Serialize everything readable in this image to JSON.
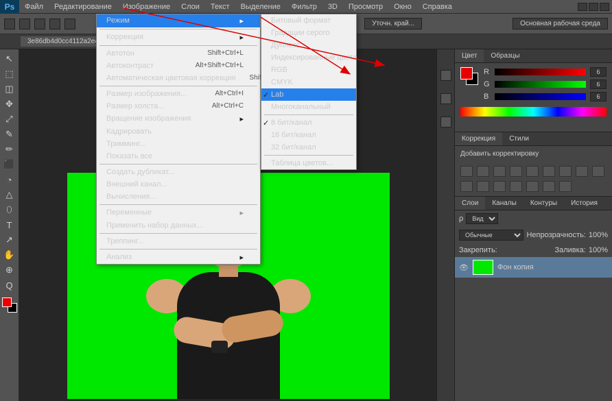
{
  "menubar": [
    "Файл",
    "Редактирование",
    "Изображение",
    "Слои",
    "Текст",
    "Выделение",
    "Фильтр",
    "3D",
    "Просмотр",
    "Окно",
    "Справка"
  ],
  "ps": "Ps",
  "optbar": {
    "btn1": "Уточн. край...",
    "btn2": "Основная рабочая среда"
  },
  "doctab": "3e86db4d0cc4112a2e4d3c6...",
  "menu_image": {
    "mode": "Режим",
    "adjustments": "Коррекция",
    "autoTone": {
      "l": "Автотон",
      "s": "Shift+Ctrl+L"
    },
    "autoContrast": {
      "l": "Автоконтраст",
      "s": "Alt+Shift+Ctrl+L"
    },
    "autoColor": {
      "l": "Автоматическая цветовая коррекция",
      "s": "Shift+Ctrl+B"
    },
    "imageSize": {
      "l": "Размер изображения...",
      "s": "Alt+Ctrl+I"
    },
    "canvasSize": {
      "l": "Размер холста...",
      "s": "Alt+Ctrl+C"
    },
    "rotation": "Вращение изображения",
    "crop": "Кадрировать",
    "trim": "Тримминг...",
    "revealAll": "Показать все",
    "duplicate": "Создать дубликат...",
    "applyImage": "Внешний канал...",
    "calculations": "Вычисления...",
    "variables": "Переменные",
    "applyDataSet": "Применить набор данных...",
    "trap": "Треппинг...",
    "analysis": "Анализ"
  },
  "submenu_mode": {
    "bitmap": "Битовый формат",
    "grayscale": "Градации серого",
    "duotone": "Дуплекс",
    "indexed": "Индексированные цвета",
    "rgb": "RGB",
    "cmyk": "CMYK",
    "lab": "Lab",
    "multichannel": "Многоканальный",
    "bit8": "8 бит/канал",
    "bit16": "16 бит/канал",
    "bit32": "32 бит/канал",
    "colorTable": "Таблица цветов..."
  },
  "panels": {
    "color": "Цвет",
    "swatches": "Образцы",
    "r": {
      "l": "R",
      "v": "6"
    },
    "g": {
      "l": "G",
      "v": "6"
    },
    "b": {
      "l": "B",
      "v": "6"
    },
    "corrections": "Коррекция",
    "styles": "Стили",
    "addAdj": "Добавить корректировку",
    "layers": "Слои",
    "channels": "Каналы",
    "paths": "Контуры",
    "history": "История",
    "kind": "Вид",
    "blend": "Обычные",
    "opacityLbl": "Непрозрачность:",
    "opacity": "100%",
    "lockLbl": "Закрепить:",
    "fillLbl": "Заливка:",
    "fill": "100%",
    "layerName": "Фон копия"
  },
  "tools_glyphs": [
    "↖",
    "⬚",
    "◫",
    "✥",
    "⤢",
    "✎",
    "✏",
    "⬛",
    "◔",
    "△",
    "⬯",
    "T",
    "↗",
    "✋",
    "⊕",
    "Q"
  ]
}
